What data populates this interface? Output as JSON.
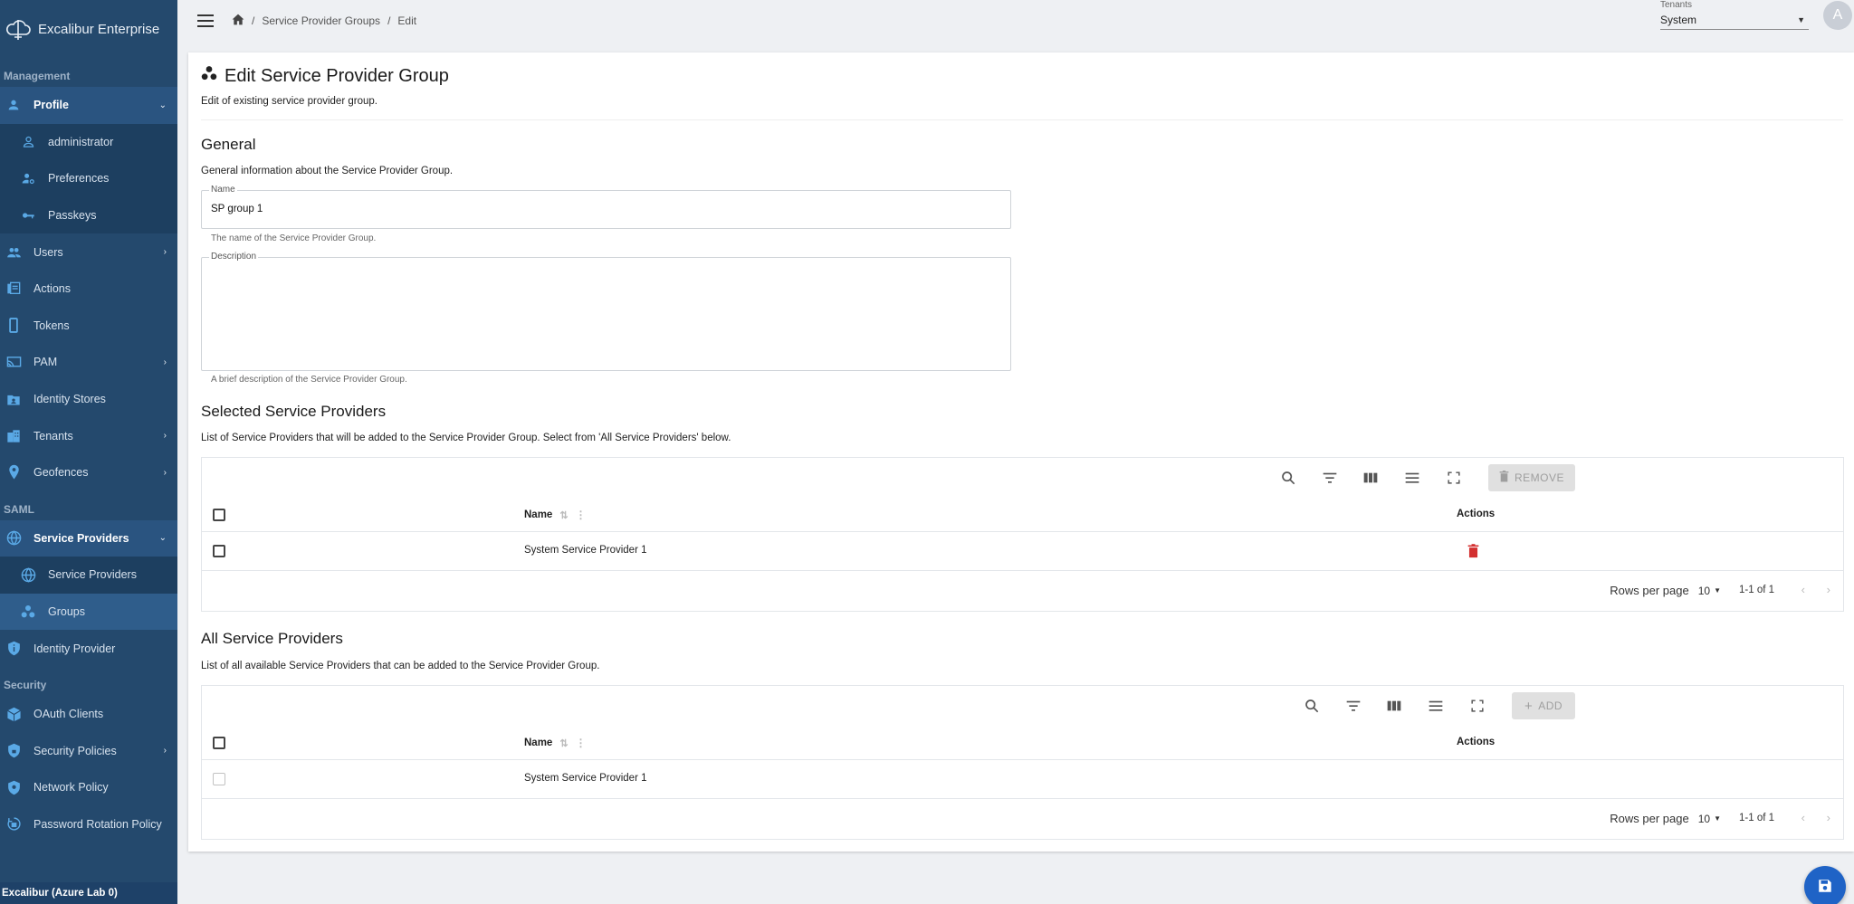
{
  "app": {
    "brand": "Excalibur Enterprise",
    "footer": "Excalibur (Azure Lab 0)"
  },
  "sidebar": {
    "sections": {
      "management": "Management",
      "saml": "SAML",
      "security": "Security"
    },
    "items": {
      "profile": "Profile",
      "administrator": "administrator",
      "preferences": "Preferences",
      "passkeys": "Passkeys",
      "users": "Users",
      "actions": "Actions",
      "tokens": "Tokens",
      "pam": "PAM",
      "identity_stores": "Identity Stores",
      "tenants": "Tenants",
      "geofences": "Geofences",
      "service_providers": "Service Providers",
      "sp_sub": "Service Providers",
      "groups": "Groups",
      "identity_provider": "Identity Provider",
      "oauth_clients": "OAuth Clients",
      "security_policies": "Security Policies",
      "network_policy": "Network Policy",
      "password_rotation": "Password Rotation Policy"
    }
  },
  "topbar": {
    "breadcrumb": [
      "Service Provider Groups",
      "Edit"
    ],
    "tenant_label": "Tenants",
    "tenant_value": "System",
    "avatar": "A"
  },
  "page": {
    "title": "Edit Service Provider Group",
    "subtitle": "Edit of existing service provider group.",
    "general": {
      "heading": "General",
      "desc": "General information about the Service Provider Group.",
      "name_label": "Name",
      "name_value": "SP group 1",
      "name_help": "The name of the Service Provider Group.",
      "desc_label": "Description",
      "desc_value": "",
      "desc_help": "A brief description of the Service Provider Group."
    },
    "selected": {
      "heading": "Selected Service Providers",
      "desc": "List of Service Providers that will be added to the Service Provider Group. Select from 'All Service Providers' below.",
      "button": "REMOVE",
      "col_name": "Name",
      "col_actions": "Actions",
      "rows": [
        "System Service Provider 1"
      ],
      "rows_per_page_label": "Rows per page",
      "rows_per_page": "10",
      "range": "1-1 of 1"
    },
    "all": {
      "heading": "All Service Providers",
      "desc": "List of all available Service Providers that can be added to the Service Provider Group.",
      "button": "ADD",
      "col_name": "Name",
      "col_actions": "Actions",
      "rows": [
        "System Service Provider 1"
      ],
      "rows_per_page_label": "Rows per page",
      "rows_per_page": "10",
      "range": "1-1 of 1"
    }
  },
  "colors": {
    "sidebar": "#24496d",
    "accent": "#1f63c6",
    "icon": "#5aa9e6",
    "delete": "#d32f2f"
  }
}
